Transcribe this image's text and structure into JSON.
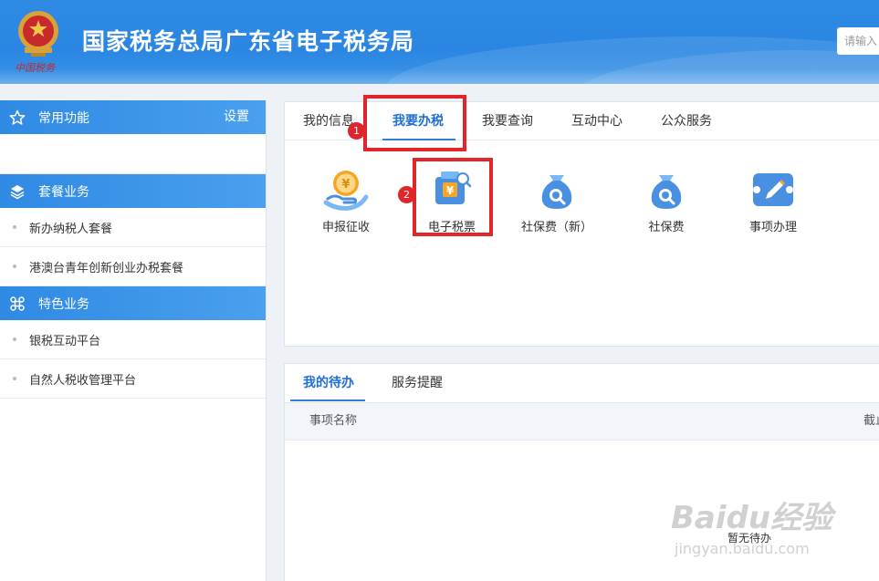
{
  "header": {
    "site_title": "国家税务总局广东省电子税务局",
    "emblem_text": "中国税务",
    "search_placeholder": "请输入"
  },
  "sidebar": {
    "common": {
      "title": "常用功能",
      "settings": "设置"
    },
    "package": {
      "title": "套餐业务",
      "items": [
        "新办纳税人套餐",
        "港澳台青年创新创业办税套餐"
      ]
    },
    "special": {
      "title": "特色业务",
      "items": [
        "银税互动平台",
        "自然人税收管理平台"
      ]
    }
  },
  "tabs": [
    "我的信息",
    "我要办税",
    "我要查询",
    "互动中心",
    "公众服务"
  ],
  "active_tab": "我要办税",
  "services": [
    {
      "label": "申报征收",
      "icon": "tax-declaration-icon"
    },
    {
      "label": "电子税票",
      "icon": "electronic-tax-ticket-icon"
    },
    {
      "label": "社保费（新）",
      "icon": "social-insurance-new-icon"
    },
    {
      "label": "社保费",
      "icon": "social-insurance-icon"
    },
    {
      "label": "事项办理",
      "icon": "matter-handling-icon"
    }
  ],
  "annotations": [
    "1",
    "2"
  ],
  "bottom_panel": {
    "tabs": [
      "我的待办",
      "服务提醒"
    ],
    "columns": [
      "事项名称",
      "截止"
    ],
    "empty_text": "暂无待办"
  },
  "watermark": {
    "line1": "Baidu经验",
    "line2": "jingyan.baidu.com"
  },
  "colors": {
    "primary": "#2f8ae4",
    "accent_blue": "#1f6fd6",
    "highlight_red": "#e0262b",
    "icon_orange": "#f5a623"
  }
}
